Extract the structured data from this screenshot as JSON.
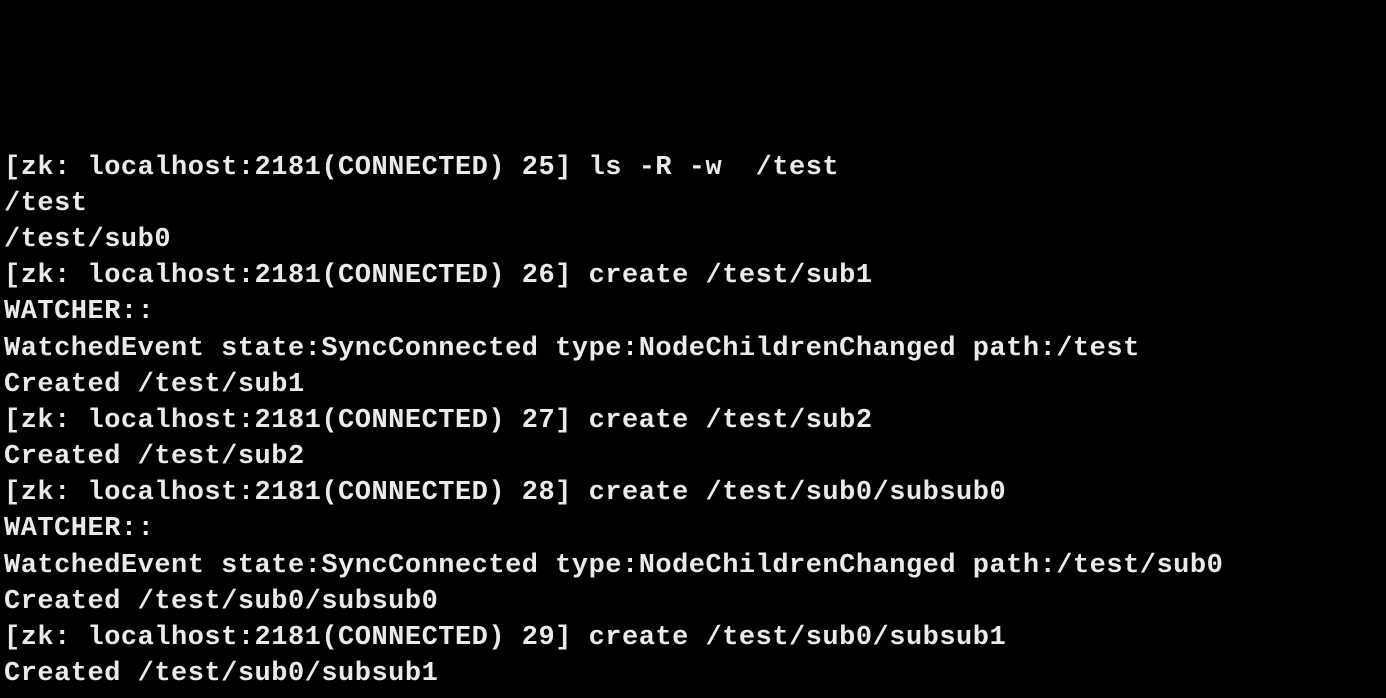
{
  "terminal": {
    "lines": [
      "[zk: localhost:2181(CONNECTED) 25] ls -R -w  /test",
      "/test",
      "/test/sub0",
      "[zk: localhost:2181(CONNECTED) 26] create /test/sub1",
      "",
      "WATCHER::",
      "",
      "WatchedEvent state:SyncConnected type:NodeChildrenChanged path:/test",
      "Created /test/sub1",
      "[zk: localhost:2181(CONNECTED) 27] create /test/sub2",
      "Created /test/sub2",
      "[zk: localhost:2181(CONNECTED) 28] create /test/sub0/subsub0",
      "",
      "WATCHER::",
      "",
      "WatchedEvent state:SyncConnected type:NodeChildrenChanged path:/test/sub0",
      "Created /test/sub0/subsub0",
      "[zk: localhost:2181(CONNECTED) 29] create /test/sub0/subsub1",
      "Created /test/sub0/subsub1"
    ]
  }
}
